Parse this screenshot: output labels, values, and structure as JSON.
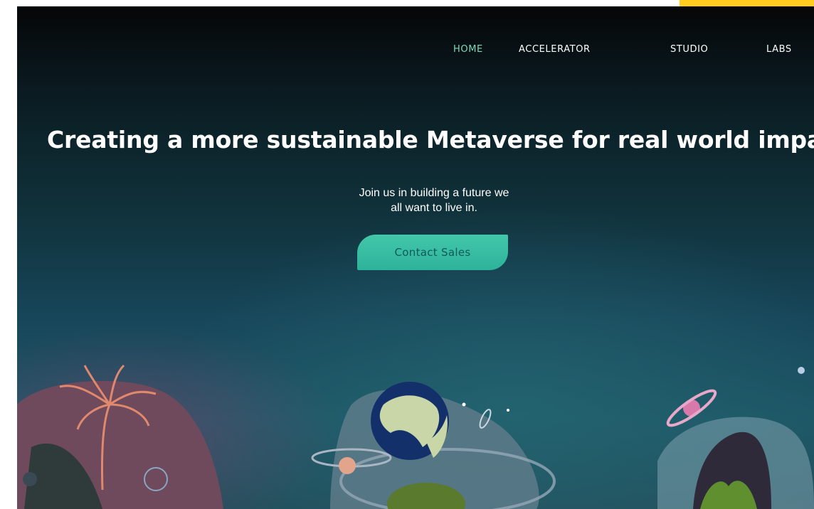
{
  "nav": {
    "items": [
      {
        "label": "HOME",
        "active": true
      },
      {
        "label": "ACCELERATOR",
        "active": false
      },
      {
        "label": "STUDIO",
        "active": false
      },
      {
        "label": "LABS",
        "active": false
      }
    ]
  },
  "hero": {
    "headline": "Creating a more sustainable Metaverse for real world impact.",
    "subtext_line1": "Join us in building a future we",
    "subtext_line2": "all want to live in.",
    "cta_label": "Contact Sales"
  },
  "colors": {
    "accent": "#ffcc1f",
    "active_nav": "#7fd8b6",
    "cta_background": "#3cc0a4",
    "cta_text": "#0f5a56"
  },
  "icons": [
    "palm-plant-illustration",
    "globe-illustration",
    "planet-ring-illustration",
    "terrarium-illustration"
  ]
}
